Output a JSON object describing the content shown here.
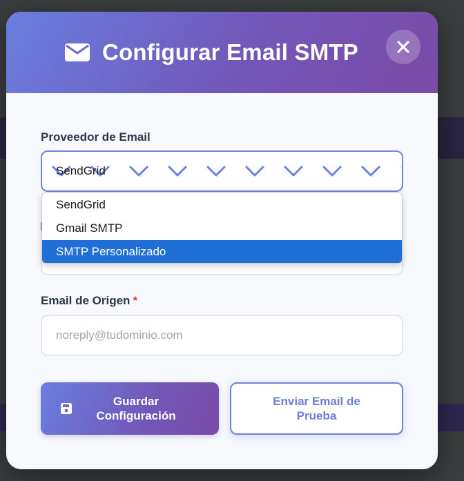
{
  "modal": {
    "title": "Configurar Email SMTP",
    "icon": "envelope-icon",
    "close_icon": "close-icon"
  },
  "provider": {
    "label": "Proveedor de Email",
    "selected_value": "SendGrid",
    "options": [
      "SendGrid",
      "Gmail SMTP",
      "SMTP Personalizado"
    ],
    "highlighted_option": "SMTP Personalizado"
  },
  "from_email": {
    "label": "Email de Origen",
    "required_mark": "*",
    "placeholder": "noreply@tudominio.com",
    "value": ""
  },
  "buttons": {
    "save_label": "Guardar Configuración",
    "save_icon": "floppy-disk-icon",
    "test_label": "Enviar Email de Prueba"
  },
  "colors": {
    "header_gradient_start": "#6a7fe0",
    "header_gradient_end": "#7a4aa6",
    "accent": "#6b82e0",
    "highlight": "#1f6fd6",
    "required": "#e53e3e"
  }
}
